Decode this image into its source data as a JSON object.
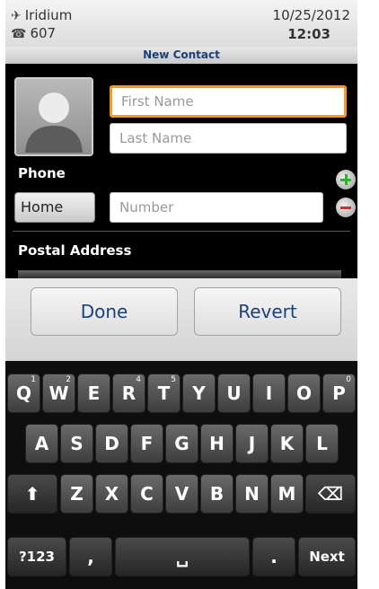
{
  "status_bar": {
    "carrier": "Iridium",
    "number": "607",
    "date": "10/25/2012",
    "time": "12:03"
  },
  "title": "New Contact",
  "form": {
    "first_name_placeholder": "First Name",
    "last_name_placeholder": "Last Name",
    "phone_label": "Phone",
    "phone_type": "Home",
    "number_placeholder": "Number",
    "postal_label": "Postal Address"
  },
  "actions": {
    "done": "Done",
    "revert": "Revert"
  },
  "keyboard": {
    "row1": [
      "Q",
      "W",
      "E",
      "R",
      "T",
      "Y",
      "U",
      "I",
      "O",
      "P"
    ],
    "row1_hints": [
      "1",
      "2",
      "",
      "4",
      "5",
      "",
      "",
      "",
      "",
      "0"
    ],
    "row2": [
      "A",
      "S",
      "D",
      "F",
      "G",
      "H",
      "J",
      "K",
      "L"
    ],
    "row3": [
      "Z",
      "X",
      "C",
      "V",
      "B",
      "N",
      "M"
    ],
    "symbols": "?123",
    "comma": ",",
    "period": ".",
    "next": "Next"
  },
  "icons": {
    "carrier": "signal-icon",
    "number": "phone-icon",
    "add": "add-icon",
    "remove": "remove-icon",
    "shift": "shift-icon",
    "backspace": "backspace-icon",
    "space": "space-icon"
  },
  "colors": {
    "focus_border": "#f09a2a",
    "accent_text": "#1d3f7a",
    "add_green": "#2bb52b",
    "remove_red": "#c83232"
  }
}
